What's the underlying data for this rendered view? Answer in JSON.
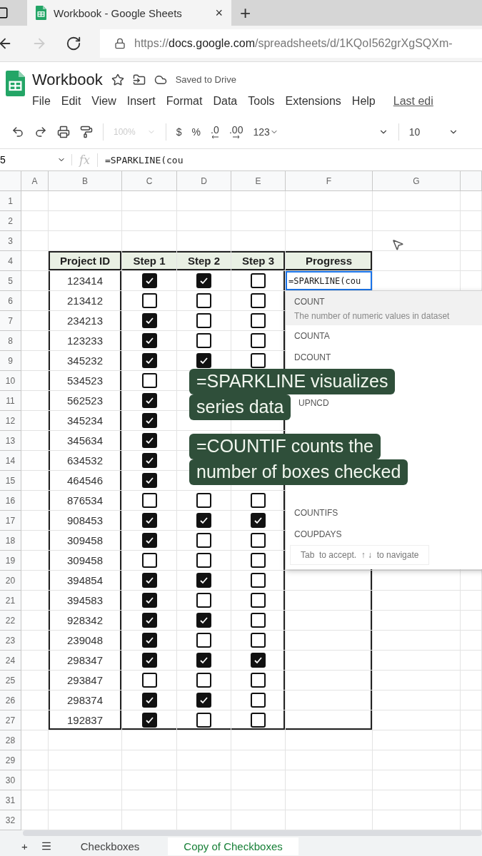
{
  "browser": {
    "tab": {
      "title": "Workbook - Google Sheets",
      "close": "×"
    },
    "new_tab": "+",
    "url": {
      "scheme": "https://",
      "host": "docs.google.com",
      "path": "/spreadsheets/d/1KQoI562grXgSQXm-"
    }
  },
  "doc": {
    "title": "Workbook",
    "save_status": "Saved to Drive",
    "menu": [
      "File",
      "Edit",
      "View",
      "Insert",
      "Format",
      "Data",
      "Tools",
      "Extensions",
      "Help"
    ],
    "last_edit": "Last edi"
  },
  "toolbar": {
    "zoom": {
      "label": "100%",
      "disabled": true
    },
    "format_buttons": [
      "$",
      "%",
      ".0",
      ".00",
      "123"
    ],
    "font_size": "10"
  },
  "formula_bar": {
    "cell_ref": "5",
    "fx": "fx",
    "formula": "=SPARKLINE(cou"
  },
  "sheet": {
    "columns": [
      "A",
      "B",
      "C",
      "D",
      "E",
      "F",
      "G"
    ],
    "row_numbers": [
      "1",
      "2",
      "3",
      "4",
      "5",
      "6",
      "7",
      "8",
      "9",
      "10",
      "11",
      "12",
      "13",
      "14",
      "15",
      "16",
      "17",
      "18",
      "19",
      "20",
      "21",
      "22",
      "23",
      "24",
      "25",
      "26",
      "27",
      "28",
      "29",
      "30",
      "31",
      "32"
    ],
    "table": {
      "headers": [
        "Project ID",
        "Step 1",
        "Step 2",
        "Step 3",
        "Progress"
      ],
      "editing_value": "=SPARKLINE(cou",
      "rows": [
        {
          "id": "123414",
          "steps": [
            {
              "checked": true
            },
            {
              "checked": true
            },
            {
              "checked": false
            }
          ]
        },
        {
          "id": "213412",
          "steps": [
            {
              "checked": false
            },
            {
              "checked": false
            },
            {
              "checked": false
            }
          ]
        },
        {
          "id": "234213",
          "steps": [
            {
              "checked": true
            },
            {
              "checked": false
            },
            {
              "checked": false
            }
          ]
        },
        {
          "id": "123233",
          "steps": [
            {
              "checked": true
            },
            {
              "checked": false
            },
            {
              "checked": false
            }
          ]
        },
        {
          "id": "345232",
          "steps": [
            {
              "checked": true
            },
            {
              "checked": true
            },
            {
              "checked": false
            }
          ]
        },
        {
          "id": "534523",
          "steps": [
            {
              "checked": false
            }
          ]
        },
        {
          "id": "562523",
          "steps": [
            {
              "checked": true
            }
          ]
        },
        {
          "id": "345234",
          "steps": [
            {
              "checked": true
            }
          ]
        },
        {
          "id": "345634",
          "steps": [
            {
              "checked": true
            }
          ]
        },
        {
          "id": "634532",
          "steps": [
            {
              "checked": true
            }
          ]
        },
        {
          "id": "464546",
          "steps": [
            {
              "checked": true
            }
          ]
        },
        {
          "id": "876534",
          "steps": [
            {
              "checked": false
            },
            {
              "checked": false
            },
            {
              "checked": false
            }
          ]
        },
        {
          "id": "908453",
          "steps": [
            {
              "checked": true
            },
            {
              "checked": true
            },
            {
              "checked": true
            }
          ]
        },
        {
          "id": "309458",
          "steps": [
            {
              "checked": true
            },
            {
              "checked": false
            },
            {
              "checked": false
            }
          ]
        },
        {
          "id": "309458",
          "steps": [
            {
              "checked": false
            },
            {
              "checked": false
            },
            {
              "checked": false
            }
          ]
        },
        {
          "id": "394854",
          "steps": [
            {
              "checked": true
            },
            {
              "checked": true
            },
            {
              "checked": false
            }
          ]
        },
        {
          "id": "394583",
          "steps": [
            {
              "checked": true
            },
            {
              "checked": false
            },
            {
              "checked": false
            }
          ]
        },
        {
          "id": "928342",
          "steps": [
            {
              "checked": true
            },
            {
              "checked": true
            },
            {
              "checked": false
            }
          ]
        },
        {
          "id": "239048",
          "steps": [
            {
              "checked": true
            },
            {
              "checked": false
            },
            {
              "checked": false
            }
          ]
        },
        {
          "id": "298347",
          "steps": [
            {
              "checked": true
            },
            {
              "checked": true
            },
            {
              "checked": true
            }
          ]
        },
        {
          "id": "293847",
          "steps": [
            {
              "checked": false
            },
            {
              "checked": false
            },
            {
              "checked": false
            }
          ]
        },
        {
          "id": "298374",
          "steps": [
            {
              "checked": true
            },
            {
              "checked": true
            },
            {
              "checked": false
            }
          ]
        },
        {
          "id": "192837",
          "steps": [
            {
              "checked": true
            },
            {
              "checked": false
            },
            {
              "checked": false
            }
          ]
        }
      ]
    }
  },
  "autocomplete": {
    "items_top": [
      {
        "name": "COUNT",
        "description": "The number of numeric values in dataset",
        "selected": true
      },
      {
        "name": "COUNTA",
        "selected": false
      },
      {
        "name": "DCOUNT",
        "selected": false
      },
      {
        "name": "UPNCD",
        "selected": false
      }
    ],
    "items_bottom": [
      {
        "name": "COUNTIFS",
        "selected": false
      },
      {
        "name": "COUPDAYS",
        "selected": false
      }
    ],
    "hint": "Tab  to accept.  ↑ ↓  to navigate"
  },
  "captions": [
    [
      "=SPARKLINE visualizes",
      "series data"
    ],
    [
      "=COUNTIF counts the",
      "number of boxes checked"
    ]
  ],
  "sheet_tabs": {
    "add": "+",
    "tabs": [
      {
        "label": "Checkboxes",
        "selected": false
      },
      {
        "label": "Copy of Checkboxes",
        "selected": true
      }
    ]
  }
}
